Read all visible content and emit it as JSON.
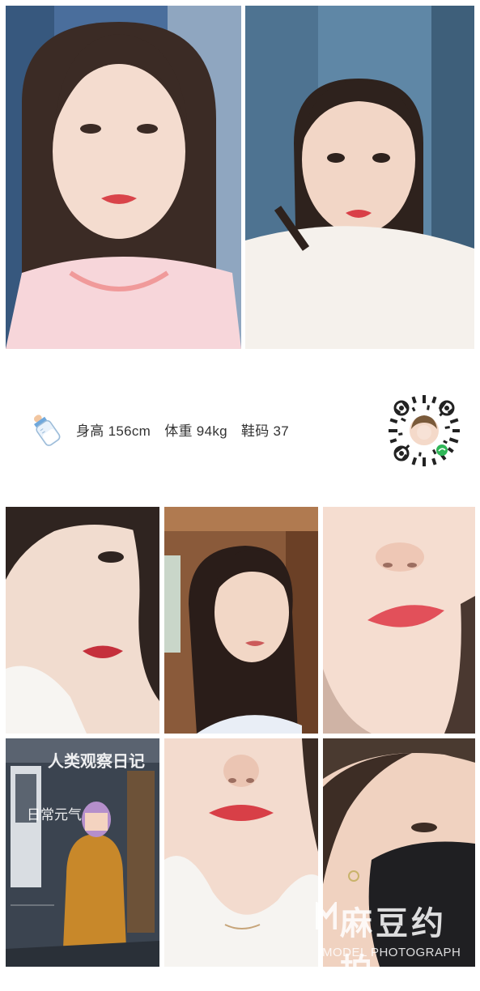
{
  "profile": {
    "height_label": "身高 156cm",
    "weight_label": "体重 94kg",
    "shoe_label": "鞋码 37"
  },
  "photos": {
    "p7_text_top": "人类观察日记",
    "p7_text_mid": "日常元气"
  },
  "watermark": {
    "brand_cn": "麻豆约拍",
    "brand_en": "MODEL PHOTOGRAPH"
  },
  "colors": {
    "lip_red": "#d9444a",
    "skin": "#f4d9c9",
    "hair_dark": "#3a2a24",
    "curtain_blue": "#5f87a6"
  }
}
